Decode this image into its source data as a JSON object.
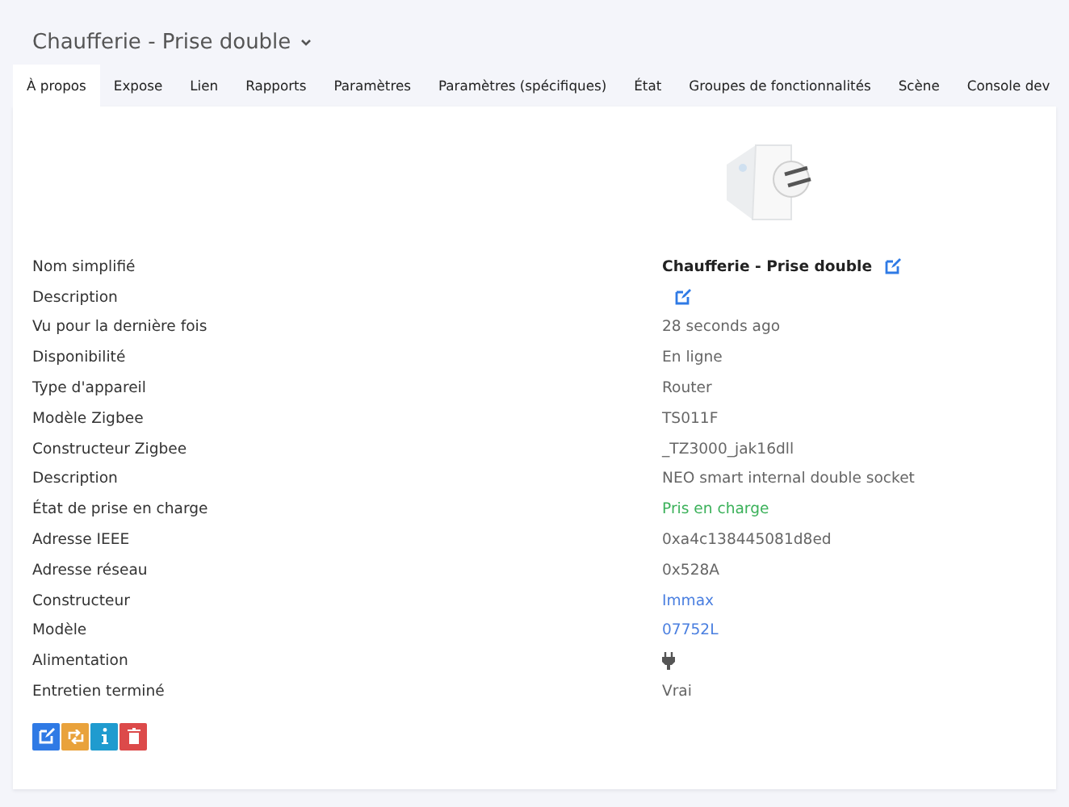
{
  "title": "Chaufferie - Prise double",
  "tabs": [
    {
      "label": "À propos",
      "selected": true
    },
    {
      "label": "Expose",
      "selected": false
    },
    {
      "label": "Lien",
      "selected": false
    },
    {
      "label": "Rapports",
      "selected": false
    },
    {
      "label": "Paramètres",
      "selected": false
    },
    {
      "label": "Paramètres (spécifiques)",
      "selected": false
    },
    {
      "label": "État",
      "selected": false
    },
    {
      "label": "Groupes de fonctionnalités",
      "selected": false
    },
    {
      "label": "Scène",
      "selected": false
    },
    {
      "label": "Console dev",
      "selected": false
    }
  ],
  "rows": [
    {
      "label": "Nom simplifié",
      "kind": "name",
      "value": "Chaufferie - Prise double"
    },
    {
      "label": "Description",
      "kind": "edit"
    },
    {
      "label": "Vu pour la dernière fois",
      "kind": "text",
      "value": "28 seconds ago"
    },
    {
      "label": "Disponibilité",
      "kind": "text",
      "value": "En ligne"
    },
    {
      "label": "Type d'appareil",
      "kind": "text",
      "value": "Router"
    },
    {
      "label": "Modèle Zigbee",
      "kind": "text",
      "value": "TS011F"
    },
    {
      "label": "Constructeur Zigbee",
      "kind": "text",
      "value": "_TZ3000_jak16dll"
    },
    {
      "label": "Description",
      "kind": "text",
      "value": "NEO smart internal double socket"
    },
    {
      "label": "État de prise en charge",
      "kind": "status",
      "value": "Pris en charge"
    },
    {
      "label": "Adresse IEEE",
      "kind": "text",
      "value": "0xa4c138445081d8ed"
    },
    {
      "label": "Adresse réseau",
      "kind": "text",
      "value": "0x528A"
    },
    {
      "label": "Constructeur",
      "kind": "link",
      "value": "Immax"
    },
    {
      "label": "Modèle",
      "kind": "link",
      "value": "07752L"
    },
    {
      "label": "Alimentation",
      "kind": "power"
    },
    {
      "label": "Entretien terminé",
      "kind": "text",
      "value": "Vrai"
    }
  ],
  "actions": [
    {
      "kind": "rename"
    },
    {
      "kind": "reconfigure"
    },
    {
      "kind": "interview"
    },
    {
      "kind": "remove"
    }
  ]
}
